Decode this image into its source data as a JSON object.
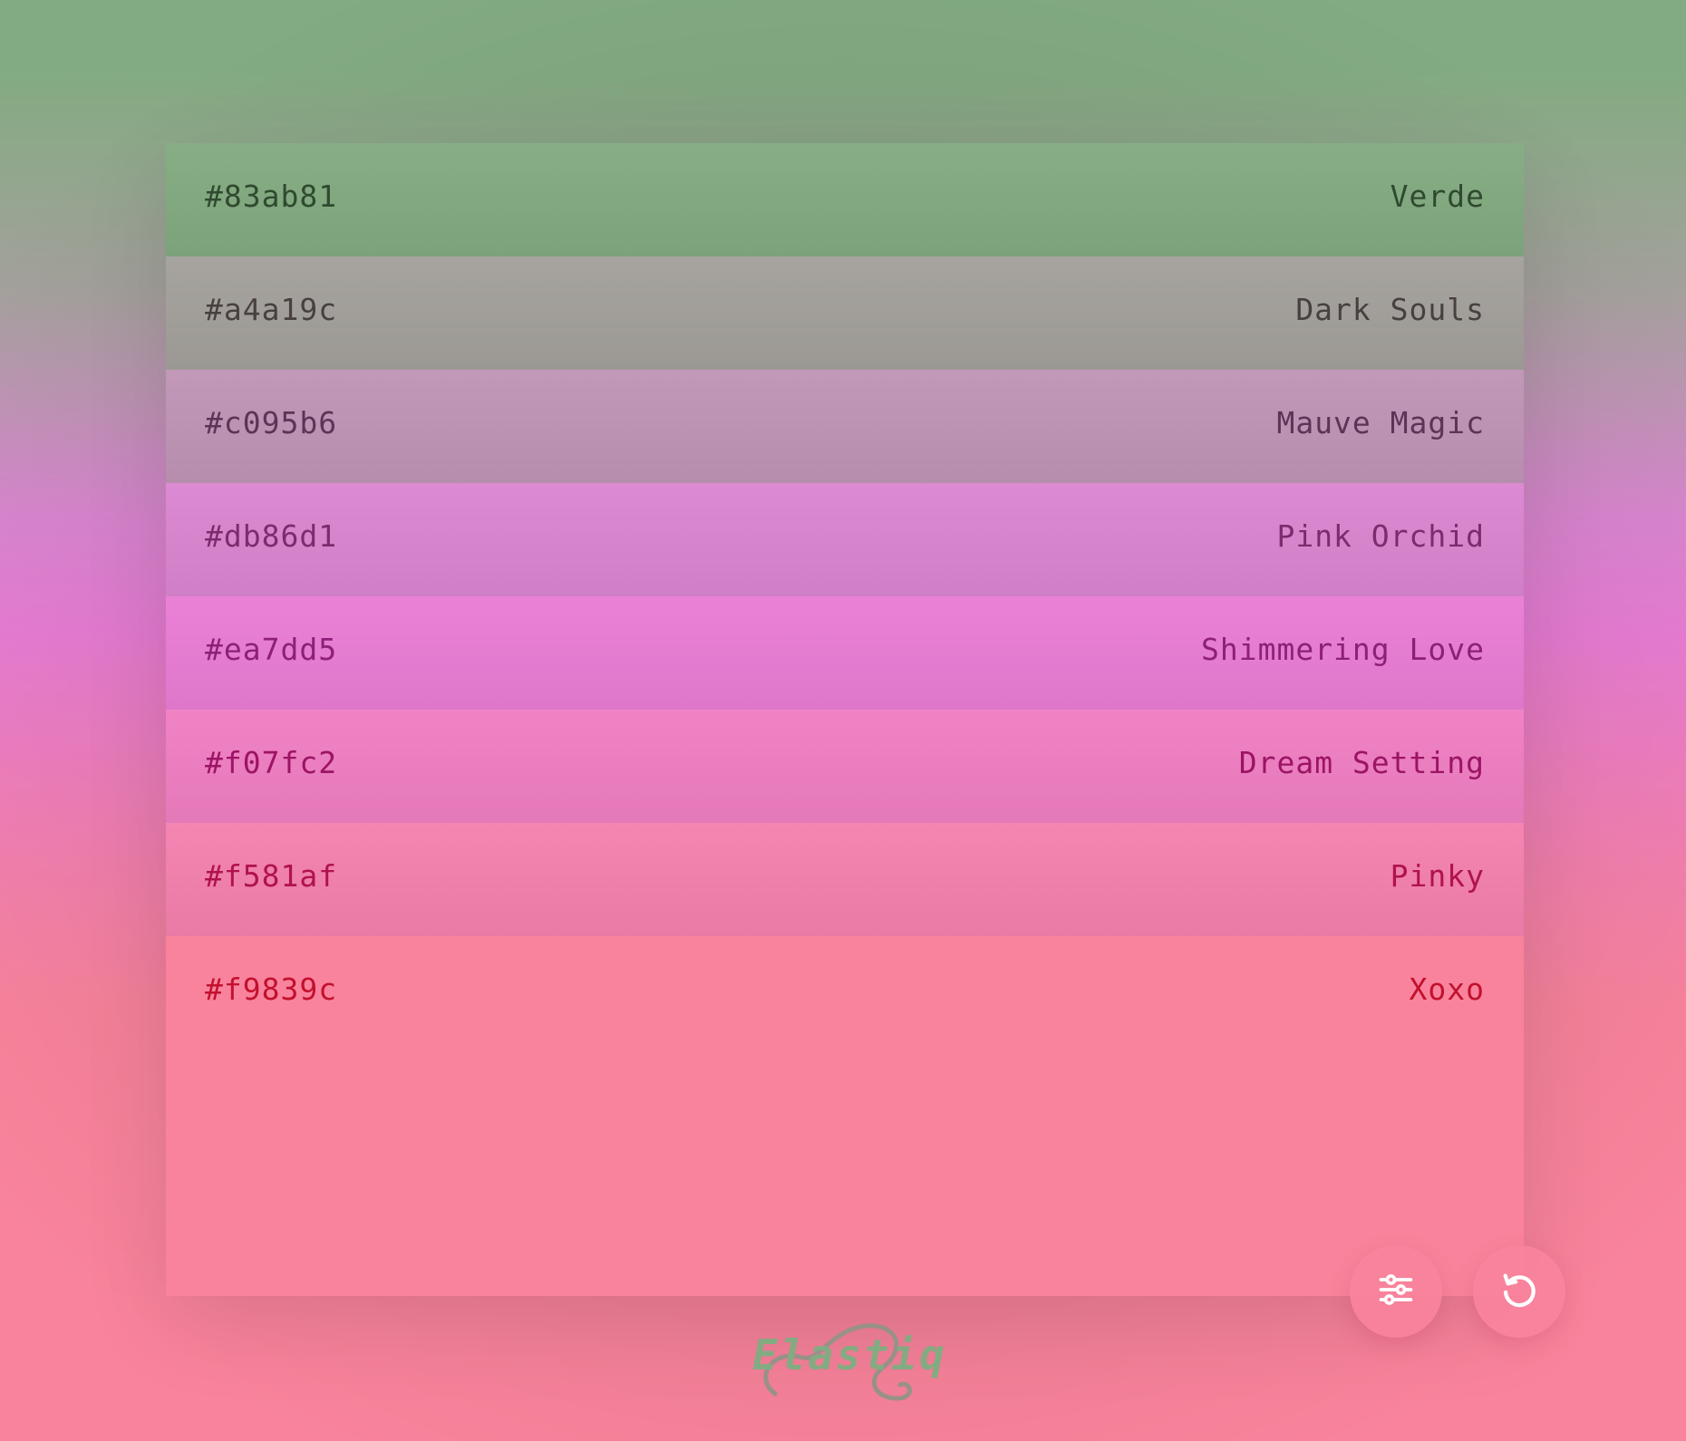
{
  "palette": {
    "swatches": [
      {
        "hex": "#83ab81",
        "name": "Verde",
        "bg": "#83ab81",
        "text_color": "#2f4a2f"
      },
      {
        "hex": "#a4a19c",
        "name": "Dark Souls",
        "bg": "#a4a19c",
        "text_color": "#48403f"
      },
      {
        "hex": "#c095b6",
        "name": "Mauve Magic",
        "bg": "#c095b6",
        "text_color": "#5e3357"
      },
      {
        "hex": "#db86d1",
        "name": "Pink Orchid",
        "bg": "#db86d1",
        "text_color": "#7a2c6d"
      },
      {
        "hex": "#ea7dd5",
        "name": "Shimmering Love",
        "bg": "#ea7dd5",
        "text_color": "#8e1f78"
      },
      {
        "hex": "#f07fc2",
        "name": "Dream Setting",
        "bg": "#f07fc2",
        "text_color": "#9c1465"
      },
      {
        "hex": "#f581af",
        "name": "Pinky",
        "bg": "#f581af",
        "text_color": "#b0124c"
      },
      {
        "hex": "#f9839c",
        "name": "Xoxo",
        "bg": "#f9839c",
        "text_color": "#c2102e"
      }
    ]
  },
  "actions": {
    "settings_icon": "sliders-icon",
    "refresh_icon": "refresh-icon"
  },
  "logo": {
    "text": "Elastiq",
    "color": "#83ab81"
  }
}
